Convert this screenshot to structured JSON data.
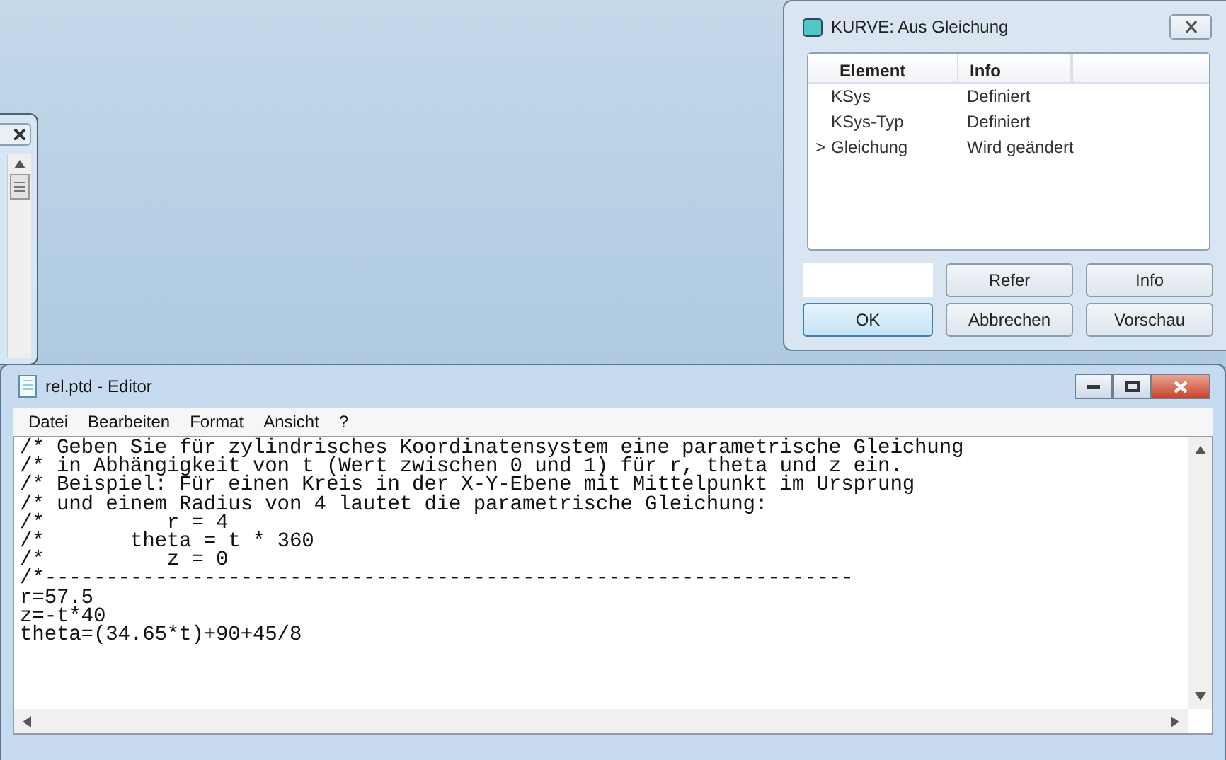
{
  "dialog": {
    "title": "KURVE: Aus Gleichung",
    "columns": [
      "Element",
      "Info"
    ],
    "rows": [
      {
        "marker": "",
        "element": "KSys",
        "info": "Definiert"
      },
      {
        "marker": "",
        "element": "KSys-Typ",
        "info": "Definiert"
      },
      {
        "marker": ">",
        "element": "Gleichung",
        "info": "Wird geändert"
      }
    ],
    "buttons": [
      {
        "label": "Refer",
        "default": false
      },
      {
        "label": "Info",
        "default": false
      },
      {
        "label": "OK",
        "default": true
      },
      {
        "label": "Abbrechen",
        "default": false
      },
      {
        "label": "Vorschau",
        "default": false
      }
    ]
  },
  "editor": {
    "title": "rel.ptd - Editor",
    "menu": [
      "Datei",
      "Bearbeiten",
      "Format",
      "Ansicht",
      "?"
    ],
    "lines": [
      "/* Geben Sie für zylindrisches Koordinatensystem eine parametrische Gleichung",
      "/* in Abhängigkeit von t (Wert zwischen 0 und 1) für r, theta und z ein.",
      "/* Beispiel: Für einen Kreis in der X-Y-Ebene mit Mittelpunkt im Ursprung",
      "/* und einem Radius von 4 lautet die parametrische Gleichung:",
      "/*          r = 4",
      "/*       theta = t * 360",
      "/*          z = 0",
      "/*------------------------------------------------------------------",
      "r=57.5",
      "z=-t*40",
      "theta=(34.65*t)+90+45/8"
    ]
  }
}
